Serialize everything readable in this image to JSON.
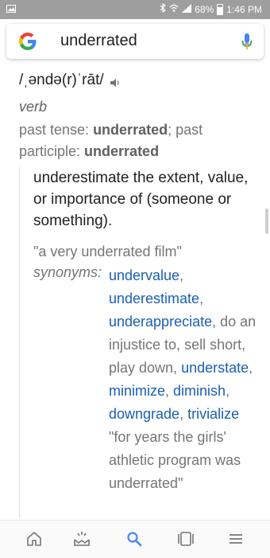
{
  "status": {
    "battery": "68%",
    "time": "1:46 PM"
  },
  "search": {
    "query": "underrated"
  },
  "entry": {
    "phonetic": "/ˌəndə(r)ˈrāt/",
    "part_of_speech": "verb",
    "forms_prefix1": "past tense: ",
    "forms_word1": "underrated",
    "forms_sep": "; past participle: ",
    "forms_word2": "underrated",
    "definition": "underestimate the extent, value, or importance of (someone or something).",
    "example": "\"a very underrated film\"",
    "synonyms_label": "synonyms:",
    "synonyms": [
      {
        "text": "undervalue",
        "linked": true,
        "sep": ", "
      },
      {
        "text": "underestimate",
        "linked": true,
        "sep": ", "
      },
      {
        "text": "underappreciate",
        "linked": true,
        "sep": ", "
      },
      {
        "text": "do an injustice to",
        "linked": false,
        "sep": ", "
      },
      {
        "text": "sell short",
        "linked": false,
        "sep": ", "
      },
      {
        "text": "play down",
        "linked": false,
        "sep": ", "
      },
      {
        "text": "understate",
        "linked": true,
        "sep": ", "
      },
      {
        "text": "minimize",
        "linked": true,
        "sep": ", "
      },
      {
        "text": "diminish",
        "linked": true,
        "sep": ", "
      },
      {
        "text": "downgrade",
        "linked": true,
        "sep": ", "
      },
      {
        "text": "trivialize",
        "linked": true,
        "sep": ""
      }
    ],
    "synonyms_example": "\"for years the girls' athletic program was underrated\""
  },
  "nav": {
    "items": [
      "home-icon",
      "updates-icon",
      "search-icon",
      "tabs-icon",
      "menu-icon"
    ],
    "active_color": "#4285f4",
    "inactive_color": "#757575"
  },
  "colors": {
    "link": "#1a5fb4",
    "status_bar": "#9e9e9e",
    "muted_text": "#757575"
  }
}
